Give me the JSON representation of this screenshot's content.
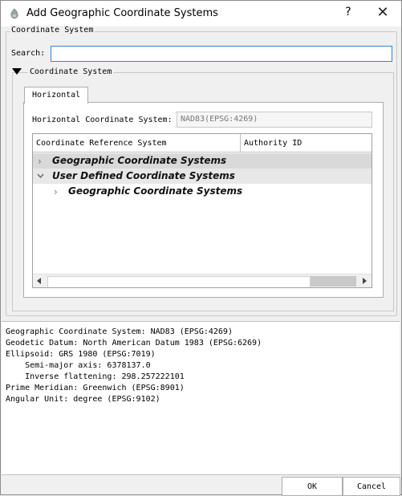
{
  "window": {
    "title": "Add Geographic Coordinate Systems",
    "help_label": "?",
    "close_label": "✕"
  },
  "coordinate_system_group": {
    "title": "Coordinate System",
    "search_label": "Search:",
    "search_value": "",
    "subgroup_title": "Coordinate System"
  },
  "tab": {
    "label": "Horizontal"
  },
  "horizontal": {
    "label": "Horizontal Coordinate System:",
    "value": "NAD83(EPSG:4269)"
  },
  "table": {
    "columns": [
      "Coordinate Reference System",
      "Authority ID"
    ],
    "rows": [
      {
        "label": "Geographic Coordinate Systems",
        "expanded": false,
        "level": 0
      },
      {
        "label": "User Defined Coordinate Systems",
        "expanded": true,
        "level": 0
      },
      {
        "label": "Geographic Coordinate Systems",
        "expanded": false,
        "level": 1
      }
    ]
  },
  "details": {
    "lines": [
      "Geographic Coordinate System: NAD83 (EPSG:4269)",
      "Geodetic Datum: North American Datum 1983 (EPSG:6269)",
      "Ellipsoid: GRS 1980 (EPSG:7019)",
      "    Semi-major axis: 6378137.0",
      "    Inverse flattening: 298.257222101",
      "Prime Meridian: Greenwich (EPSG:8901)",
      "Angular Unit: degree (EPSG:9102)"
    ]
  },
  "buttons": {
    "ok": "OK",
    "cancel": "Cancel"
  },
  "colors": {
    "row_selected": "#d9d9d9",
    "row_hover": "#e8e8e8",
    "focus_border": "#2f84d6"
  }
}
